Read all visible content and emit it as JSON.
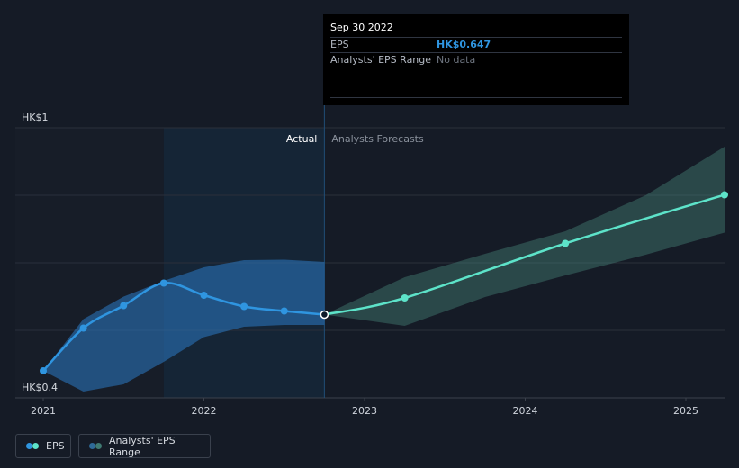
{
  "chart_data": {
    "type": "line",
    "y_axis": {
      "top_label": "HK$1",
      "bottom_label": "HK$0.4",
      "ylim": [
        0.4,
        1.0
      ]
    },
    "x_ticks": [
      "2021",
      "2022",
      "2023",
      "2024",
      "2025"
    ],
    "section_labels": {
      "actual": "Actual",
      "forecast": "Analysts Forecasts"
    },
    "series": [
      {
        "name": "EPS",
        "kind": "actual",
        "color": "#2f95e0",
        "points": [
          {
            "x": 2021.0,
            "y": 0.46
          },
          {
            "x": 2021.25,
            "y": 0.555
          },
          {
            "x": 2021.5,
            "y": 0.605
          },
          {
            "x": 2021.75,
            "y": 0.655
          },
          {
            "x": 2022.0,
            "y": 0.628
          },
          {
            "x": 2022.25,
            "y": 0.603
          },
          {
            "x": 2022.5,
            "y": 0.593
          },
          {
            "x": 2022.75,
            "y": 0.585
          }
        ],
        "range": {
          "upper": [
            [
              2021.0,
              0.46
            ],
            [
              2021.25,
              0.575
            ],
            [
              2021.5,
              0.625
            ],
            [
              2021.75,
              0.66
            ],
            [
              2022.0,
              0.69
            ],
            [
              2022.25,
              0.706
            ],
            [
              2022.5,
              0.707
            ],
            [
              2022.75,
              0.702
            ]
          ],
          "lower": [
            [
              2021.0,
              0.46
            ],
            [
              2021.25,
              0.414
            ],
            [
              2021.5,
              0.43
            ],
            [
              2021.75,
              0.48
            ],
            [
              2022.0,
              0.535
            ],
            [
              2022.25,
              0.558
            ],
            [
              2022.5,
              0.562
            ],
            [
              2022.75,
              0.562
            ]
          ]
        }
      },
      {
        "name": "EPS forecast",
        "kind": "forecast",
        "color": "#5de3c9",
        "points": [
          {
            "x": 2022.75,
            "y": 0.585
          },
          {
            "x": 2023.25,
            "y": 0.622
          },
          {
            "x": 2024.25,
            "y": 0.743
          },
          {
            "x": 2025.25,
            "y": 0.852
          }
        ],
        "range": {
          "upper": [
            [
              2022.75,
              0.585
            ],
            [
              2023.25,
              0.668
            ],
            [
              2023.75,
              0.72
            ],
            [
              2024.25,
              0.77
            ],
            [
              2024.75,
              0.85
            ],
            [
              2025.25,
              0.96
            ]
          ],
          "lower": [
            [
              2022.75,
              0.585
            ],
            [
              2023.25,
              0.56
            ],
            [
              2023.75,
              0.624
            ],
            [
              2024.25,
              0.672
            ],
            [
              2024.75,
              0.718
            ],
            [
              2025.25,
              0.768
            ]
          ]
        }
      }
    ],
    "hover": {
      "x": 2022.75,
      "date": "Sep 30 2022"
    },
    "grid": true,
    "legend_position": "bottom-left"
  },
  "tooltip": {
    "date": "Sep 30 2022",
    "rows": [
      {
        "label": "EPS",
        "value": "HK$0.647",
        "value_color": "#2f95e0"
      },
      {
        "label": "Analysts' EPS Range",
        "value": "No data",
        "value_color": "#6e7580"
      }
    ]
  },
  "legend": [
    {
      "label": "EPS",
      "colors": [
        "#2f95e0",
        "#5de3c9"
      ]
    },
    {
      "label": "Analysts' EPS Range",
      "colors": [
        "#2e6a98",
        "#3f7a72"
      ]
    }
  ]
}
